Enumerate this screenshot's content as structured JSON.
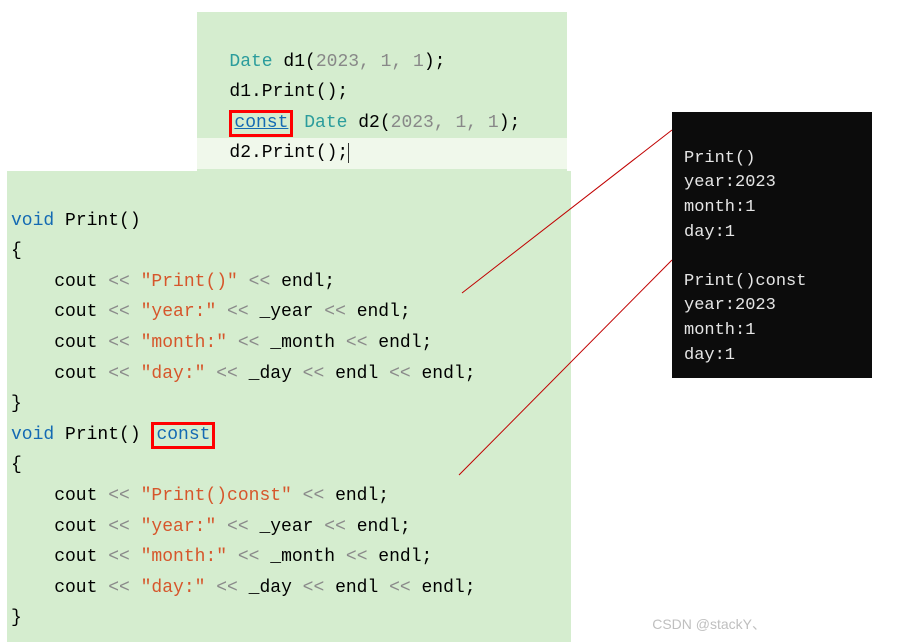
{
  "top_code": {
    "l1": {
      "type": "Date",
      "decl": " d1(",
      "args": "2023, 1, 1",
      "end": ");"
    },
    "l2": {
      "call": "d1.Print();"
    },
    "l3": {
      "const": "const",
      "type": " Date",
      "decl": " d2(",
      "args": "2023, 1, 1",
      "end": ");"
    },
    "l4": {
      "call": "d2.Print();"
    }
  },
  "bottom_code": {
    "fn1_sig": {
      "void": "void",
      "name": " Print()"
    },
    "brace_open": "{",
    "cout1": {
      "pre": "    cout ",
      "op": "<<",
      "str": " \"Print()\" ",
      "op2": "<<",
      "endl": " endl;"
    },
    "cout2": {
      "pre": "    cout ",
      "op": "<<",
      "str": " \"year:\" ",
      "op2": "<<",
      "mid": " _year ",
      "op3": "<<",
      "endl": " endl;"
    },
    "cout3": {
      "pre": "    cout ",
      "op": "<<",
      "str": " \"month:\" ",
      "op2": "<<",
      "mid": " _month ",
      "op3": "<<",
      "endl": " endl;"
    },
    "cout4": {
      "pre": "    cout ",
      "op": "<<",
      "str": " \"day:\" ",
      "op2": "<<",
      "mid": " _day ",
      "op3": "<<",
      "endl2": " endl ",
      "op4": "<<",
      "endl": " endl;"
    },
    "brace_close": "}",
    "fn2_sig": {
      "void": "void",
      "name": " Print() ",
      "const": "const"
    },
    "cout5": {
      "pre": "    cout ",
      "op": "<<",
      "str": " \"Print()const\" ",
      "op2": "<<",
      "endl": " endl;"
    },
    "cout6": {
      "pre": "    cout ",
      "op": "<<",
      "str": " \"year:\" ",
      "op2": "<<",
      "mid": " _year ",
      "op3": "<<",
      "endl": " endl;"
    },
    "cout7": {
      "pre": "    cout ",
      "op": "<<",
      "str": " \"month:\" ",
      "op2": "<<",
      "mid": " _month ",
      "op3": "<<",
      "endl": " endl;"
    },
    "cout8": {
      "pre": "    cout ",
      "op": "<<",
      "str": " \"day:\" ",
      "op2": "<<",
      "mid": " _day ",
      "op3": "<<",
      "endl2": " endl ",
      "op4": "<<",
      "endl": " endl;"
    }
  },
  "output": {
    "l1": "Print()",
    "l2": "year:2023",
    "l3": "month:1",
    "l4": "day:1",
    "blank": "",
    "l5": "Print()const",
    "l6": "year:2023",
    "l7": "month:1",
    "l8": "day:1"
  },
  "watermark": "CSDN @stackY、"
}
